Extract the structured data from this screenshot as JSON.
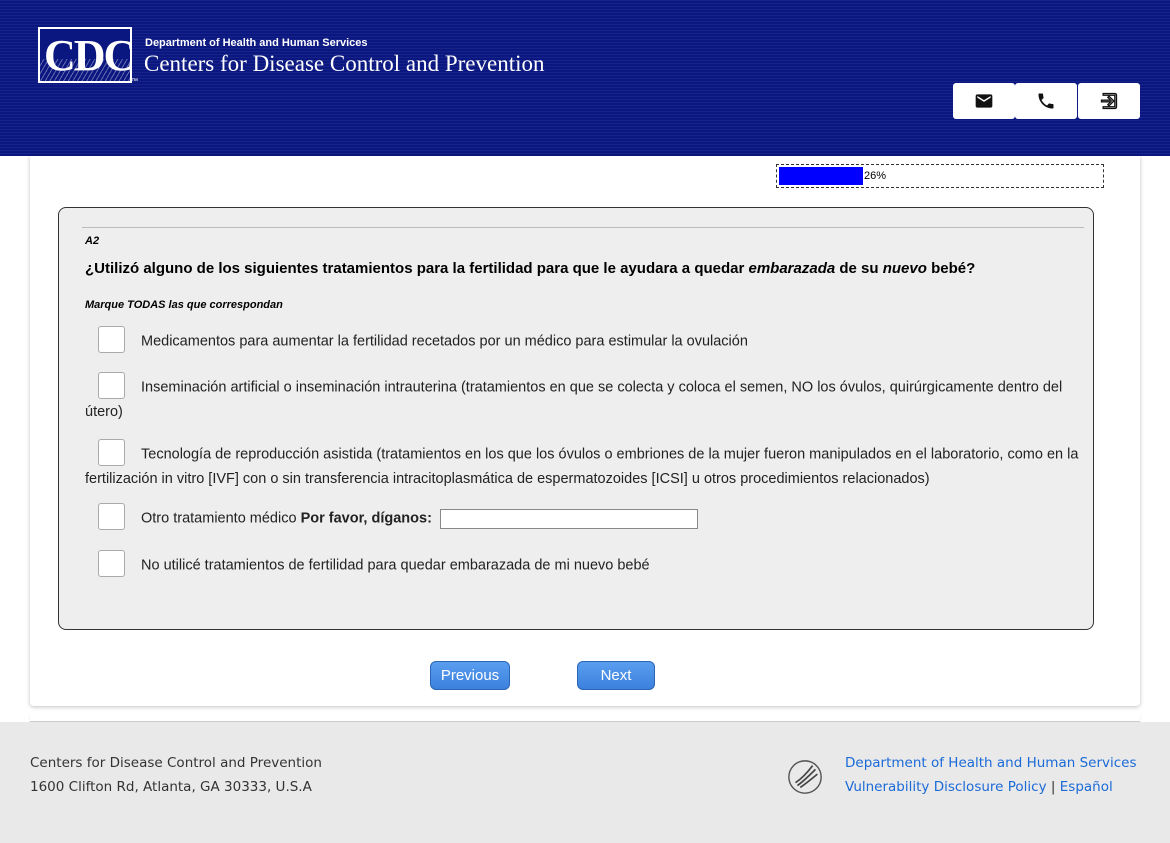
{
  "header": {
    "logo_text": "CDC",
    "logo_tm": "™",
    "dept": "Department of Health and Human Services",
    "org": "Centers for Disease Control and Prevention",
    "buttons": [
      {
        "icon": "mail-icon"
      },
      {
        "icon": "phone-icon"
      },
      {
        "icon": "sign-out-icon"
      }
    ]
  },
  "progress": {
    "percent": 26,
    "label": "26%"
  },
  "question": {
    "number": "A2",
    "text_before": "¿Utilizó alguno de los siguientes tratamientos para la fertilidad para que le ayudara a quedar ",
    "text_em1": "embarazada",
    "text_mid": " de su ",
    "text_em2": "nuevo",
    "text_after": " bebé?",
    "instruction": "Marque TODAS las que correspondan",
    "options": [
      {
        "label": "Medicamentos para aumentar la fertilidad recetados por un médico para estimular la ovulación"
      },
      {
        "label": "Inseminación artificial o inseminación intrauterina (tratamientos en que se colecta y coloca el semen, NO los óvulos, quirúrgicamente dentro del útero)"
      },
      {
        "label": "Tecnología de reproducción asistida (tratamientos en los que los óvulos o embriones de la mujer fueron manipulados en el laboratorio, como en la fertilización in vitro [IVF] con o sin transferencia intracitoplasmática de espermatozoides [ICSI] u otros procedimientos relacionados)"
      },
      {
        "label": "Otro tratamiento médico ",
        "label_bold": "Por favor, díganos:",
        "input_value": ""
      },
      {
        "label": "No utilicé tratamientos de fertilidad para quedar embarazada de mi nuevo bebé"
      }
    ]
  },
  "nav": {
    "previous": "Previous",
    "next": "Next"
  },
  "footer": {
    "org": "Centers for Disease Control and Prevention",
    "address": "1600 Clifton Rd, Atlanta, GA 30333, U.S.A",
    "hhs_link": "Department of Health and Human Services",
    "vdp_link": "Vulnerability Disclosure Policy",
    "separator": "|",
    "espanol_link": "Español"
  },
  "colors": {
    "header_bg": "#0b1780",
    "progress_fill": "#0000ff",
    "link": "#1a6ad8",
    "button": "#3b80dc"
  }
}
